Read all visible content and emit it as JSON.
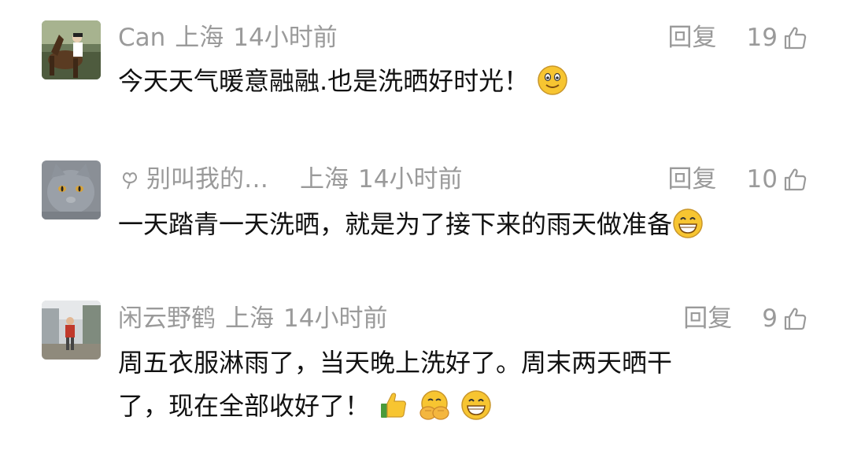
{
  "comments": [
    {
      "author": "Can",
      "location": "上海",
      "time": "14小时前",
      "reply_label": "回复",
      "likes": "19",
      "text": "今天天气暖意融融.也是洗晒好时光！"
    },
    {
      "author": "别叫我的…",
      "location": "上海",
      "time": "14小时前",
      "reply_label": "回复",
      "likes": "10",
      "text": "一天踏青一天洗晒，就是为了接下来的雨天做准备"
    },
    {
      "author": "闲云野鹤",
      "location": "上海",
      "time": "14小时前",
      "reply_label": "回复",
      "likes": "9",
      "text_line1": "周五衣服淋雨了，当天晚上洗好了。周末两天晒干",
      "text_line2": "了，现在全部收好了！"
    }
  ],
  "icons": {
    "like": "thumbs-up-icon",
    "smile": "smile-emoji-icon",
    "grin": "grin-emoji-icon",
    "thumbs_emoji": "thumbs-up-emoji-icon",
    "fist": "fist-hand-emoji-icon",
    "name_symbol": "flower-icon"
  },
  "colors": {
    "meta_text": "#9a9a9a",
    "body_text": "#111111",
    "emoji_yellow": "#f7c531"
  }
}
